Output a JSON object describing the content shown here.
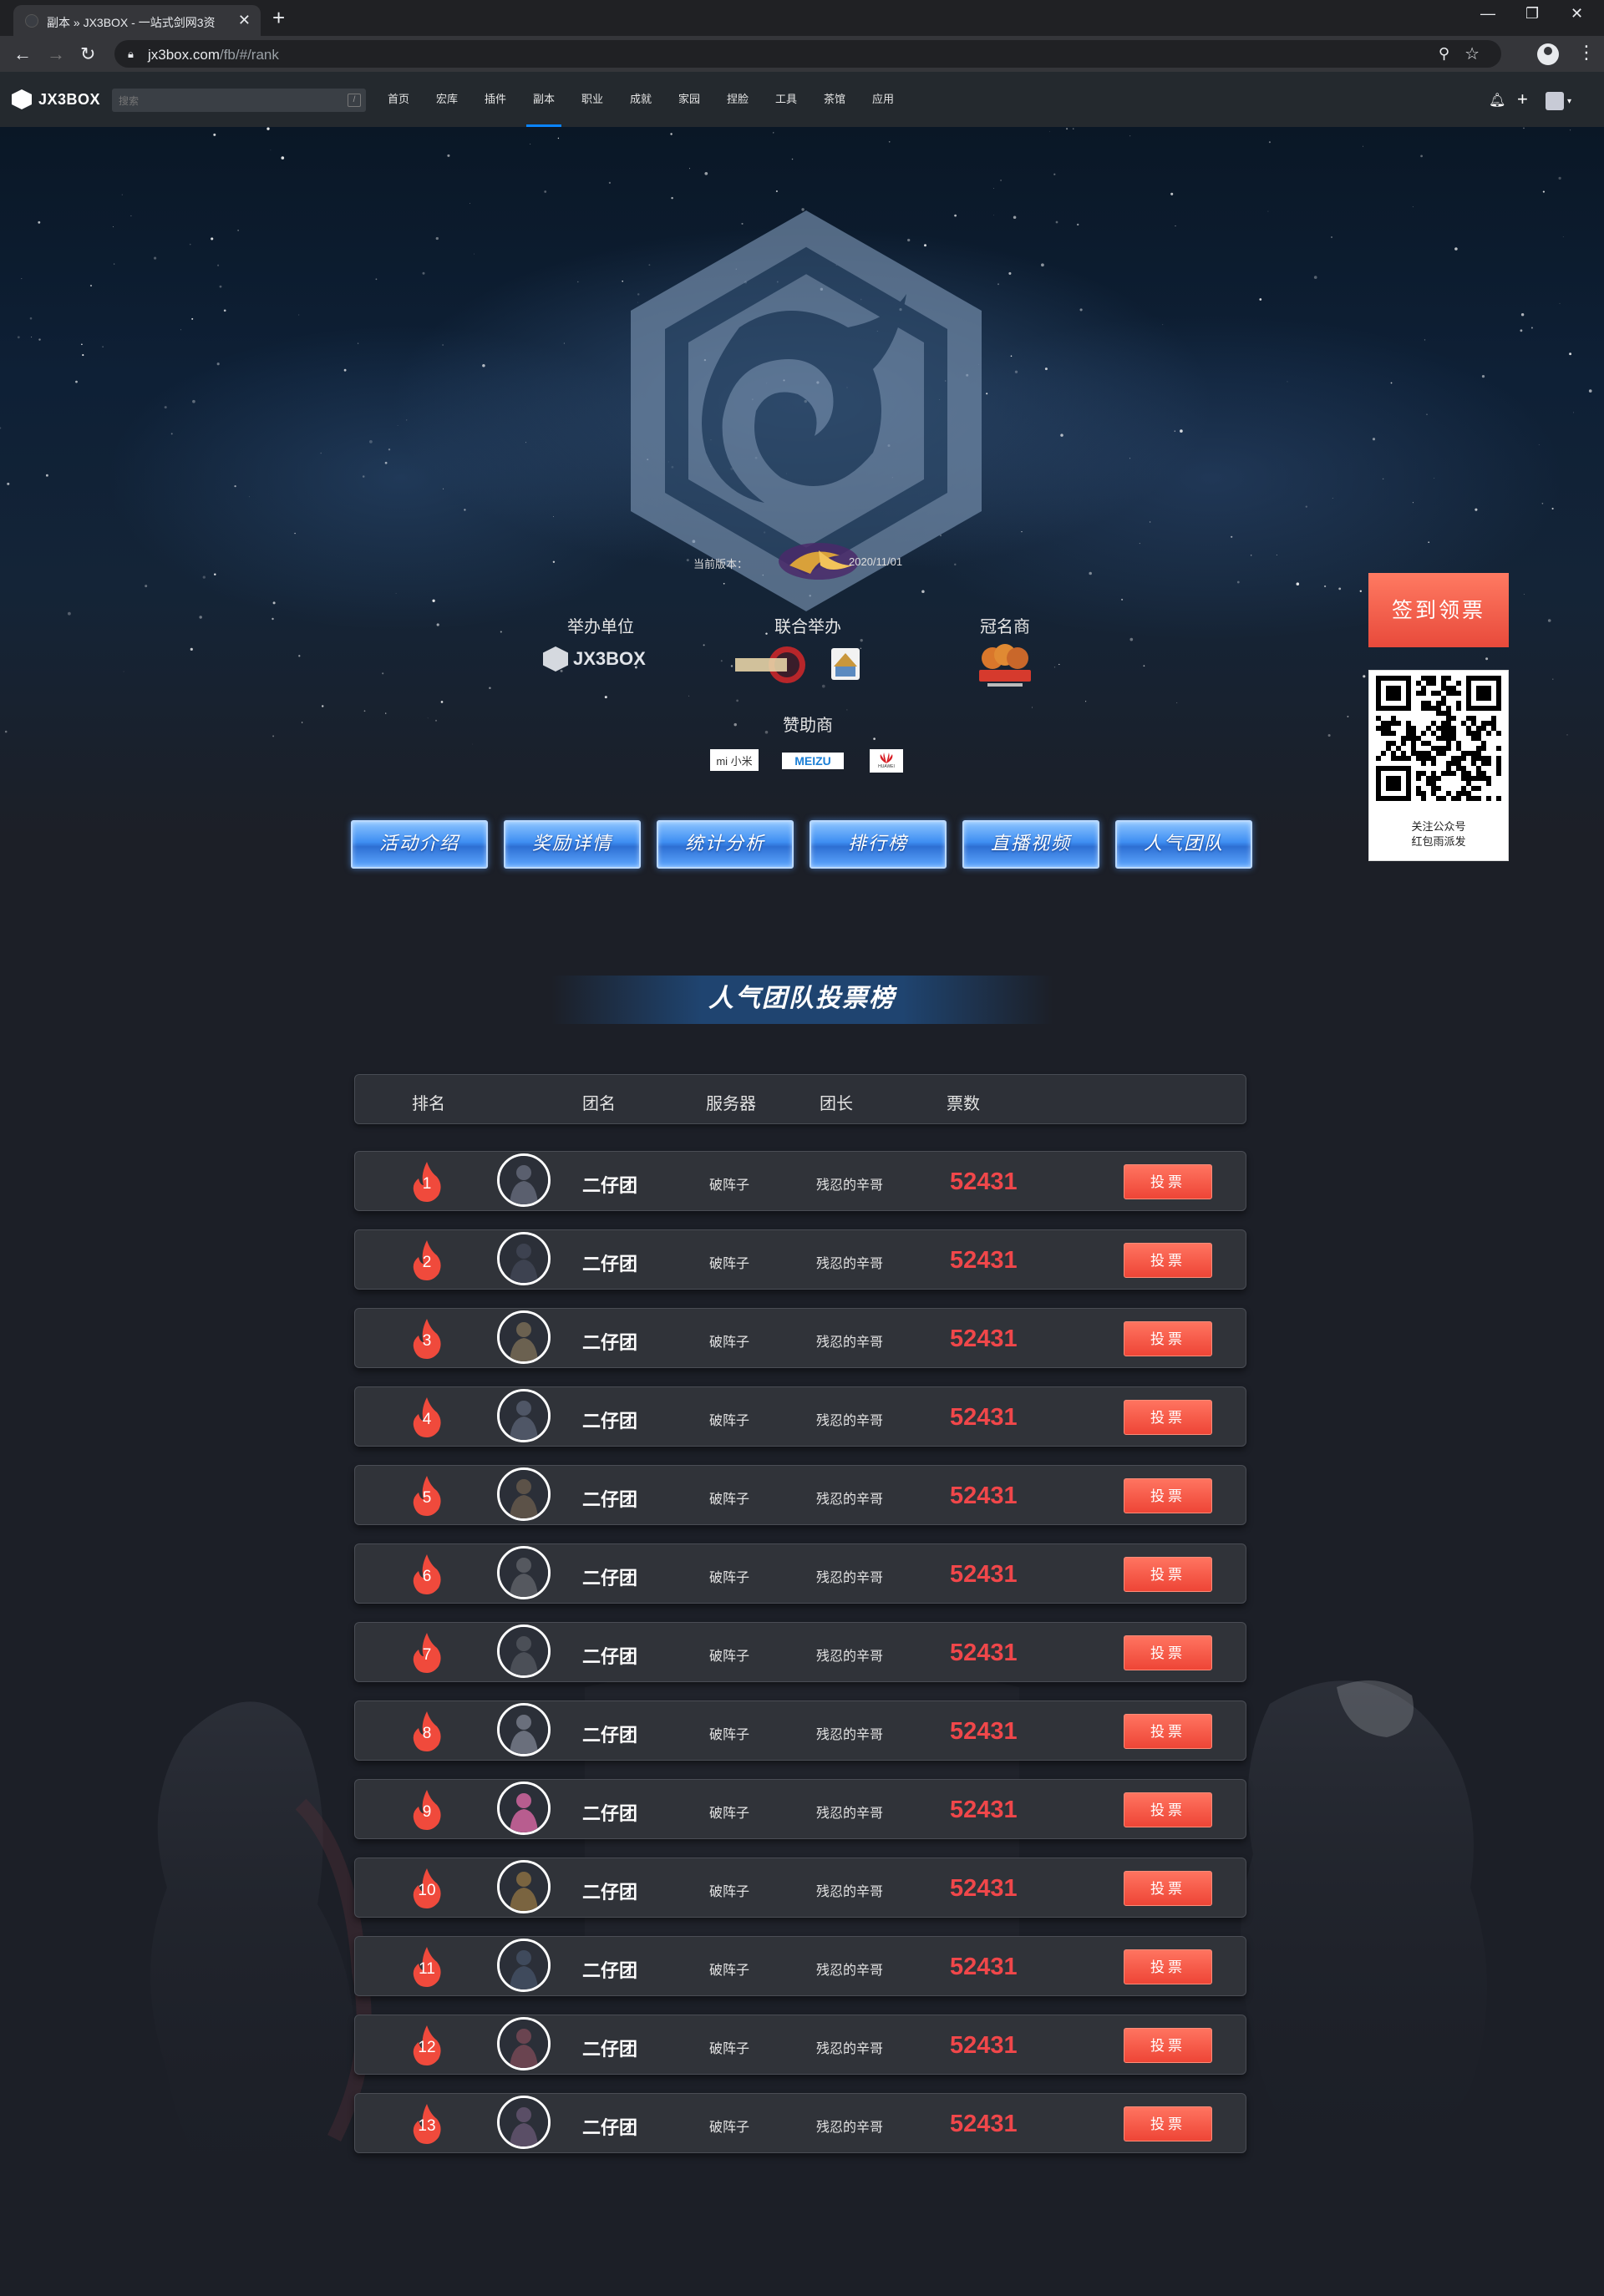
{
  "browser": {
    "tab_title": "副本 » JX3BOX - 一站式剑网3资",
    "url_host": "jx3box.com",
    "url_path": "/fb/#/rank"
  },
  "site": {
    "logo_text": "JX3BOX",
    "search_placeholder": "搜索",
    "nav": [
      "首页",
      "宏库",
      "插件",
      "副本",
      "职业",
      "成就",
      "家园",
      "捏脸",
      "工具",
      "茶馆",
      "应用"
    ],
    "active_nav": "副本"
  },
  "hero": {
    "version_label": "当前版本：",
    "version_date": "2020/11/01",
    "organizer_heading": "举办单位",
    "organizer_brand": "JX3BOX",
    "co_host_heading": "联合举办",
    "title_sponsor_heading": "冠名商",
    "sponsors_heading": "赞助商",
    "sponsor_brands": [
      "mi 小米",
      "MEIZU",
      "HUAWEI"
    ]
  },
  "activity_nav": [
    "活动介绍",
    "奖励详情",
    "统计分析",
    "排行榜",
    "直播视频",
    "人气团队"
  ],
  "sidebar": {
    "sign_in": "签到领票",
    "qr_caption_line1": "关注公众号",
    "qr_caption_line2": "红包雨派发"
  },
  "ranking": {
    "title": "人气团队投票榜",
    "headers": {
      "rank": "排名",
      "team": "团名",
      "server": "服务器",
      "leader": "团长",
      "votes": "票数"
    },
    "vote_label": "投票",
    "rows": [
      {
        "rank": "1",
        "team": "二仔团",
        "server": "破阵子",
        "leader": "残忍的辛哥",
        "votes": "52431"
      },
      {
        "rank": "2",
        "team": "二仔团",
        "server": "破阵子",
        "leader": "残忍的辛哥",
        "votes": "52431"
      },
      {
        "rank": "3",
        "team": "二仔团",
        "server": "破阵子",
        "leader": "残忍的辛哥",
        "votes": "52431"
      },
      {
        "rank": "4",
        "team": "二仔团",
        "server": "破阵子",
        "leader": "残忍的辛哥",
        "votes": "52431"
      },
      {
        "rank": "5",
        "team": "二仔团",
        "server": "破阵子",
        "leader": "残忍的辛哥",
        "votes": "52431"
      },
      {
        "rank": "6",
        "team": "二仔团",
        "server": "破阵子",
        "leader": "残忍的辛哥",
        "votes": "52431"
      },
      {
        "rank": "7",
        "team": "二仔团",
        "server": "破阵子",
        "leader": "残忍的辛哥",
        "votes": "52431"
      },
      {
        "rank": "8",
        "team": "二仔团",
        "server": "破阵子",
        "leader": "残忍的辛哥",
        "votes": "52431"
      },
      {
        "rank": "9",
        "team": "二仔团",
        "server": "破阵子",
        "leader": "残忍的辛哥",
        "votes": "52431"
      },
      {
        "rank": "10",
        "team": "二仔团",
        "server": "破阵子",
        "leader": "残忍的辛哥",
        "votes": "52431"
      },
      {
        "rank": "11",
        "team": "二仔团",
        "server": "破阵子",
        "leader": "残忍的辛哥",
        "votes": "52431"
      },
      {
        "rank": "12",
        "team": "二仔团",
        "server": "破阵子",
        "leader": "残忍的辛哥",
        "votes": "52431"
      },
      {
        "rank": "13",
        "team": "二仔团",
        "server": "破阵子",
        "leader": "残忍的辛哥",
        "votes": "52431"
      }
    ]
  },
  "colors": {
    "accent_blue": "#0a84ff",
    "vote_red": "#f0474a",
    "button_red": "#ee4536"
  }
}
